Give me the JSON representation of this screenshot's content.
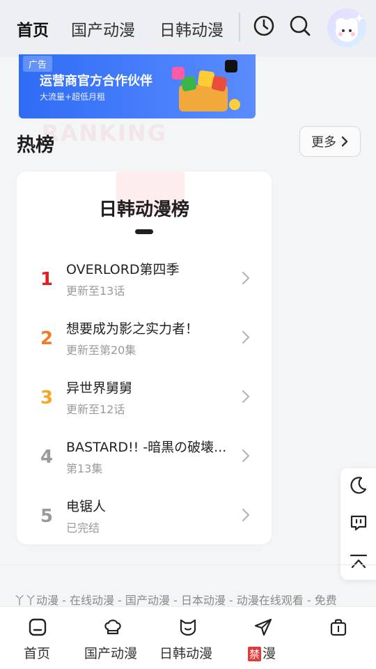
{
  "header": {
    "tabs": [
      {
        "label": "首页",
        "active": true
      },
      {
        "label": "国产动漫",
        "active": false
      },
      {
        "label": "日韩动漫",
        "active": false
      }
    ],
    "icons": [
      "history-icon",
      "search-icon",
      "avatar"
    ]
  },
  "ad": {
    "tag": "广告",
    "title": "运营商官方合作伙伴",
    "subtitle": "大流量+超低月租"
  },
  "hot": {
    "title": "热榜",
    "watermark": "RANKING",
    "more_label": "更多"
  },
  "ranking": {
    "title": "日韩动漫榜",
    "items": [
      {
        "rank": "1",
        "name": "OVERLORD第四季",
        "status": "更新至13话",
        "color": "#e02020"
      },
      {
        "rank": "2",
        "name": "想要成为影之实力者！",
        "status": "更新至第20集",
        "color": "#f07c28"
      },
      {
        "rank": "3",
        "name": "异世界舅舅",
        "status": "更新至12话",
        "color": "#f5a623"
      },
      {
        "rank": "4",
        "name": "BASTARD!! -暗黒の破壊...",
        "status": "第13集",
        "color": "#9a9a9a"
      },
      {
        "rank": "5",
        "name": "电锯人",
        "status": "已完结",
        "color": "#9a9a9a"
      }
    ]
  },
  "side_tools": [
    "moon-icon",
    "feedback-icon",
    "back-to-top-icon"
  ],
  "footer": {
    "links": "丫丫动漫 - 在线动漫 - 国产动漫 - 日本动漫 - 动漫在线观看 - 免费"
  },
  "tabbar": {
    "items": [
      {
        "label": "首页",
        "icon": "home-icon"
      },
      {
        "label": "国产动漫",
        "icon": "chef-hat-icon"
      },
      {
        "label": "日韩动漫",
        "icon": "cat-face-icon"
      },
      {
        "label": "漫",
        "badge": "禁",
        "icon": "paper-plane-icon"
      },
      {
        "label": "",
        "icon": "bag-icon"
      }
    ]
  },
  "colors": {
    "accent_yellow": "#ffd25c",
    "ad_blue": "#2f6cf5"
  }
}
